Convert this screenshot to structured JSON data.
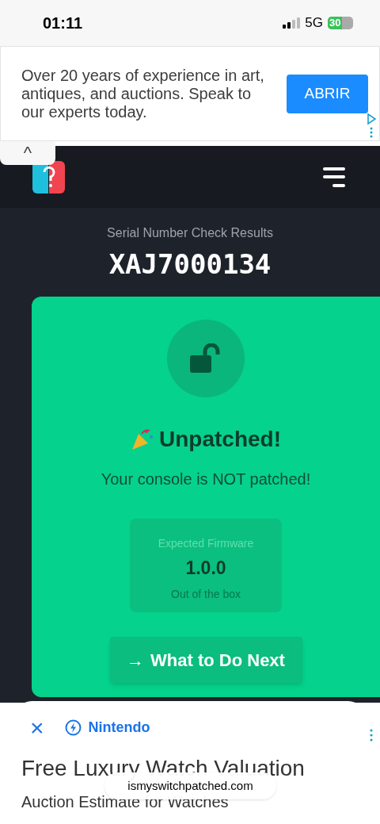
{
  "status_bar": {
    "time": "01:11",
    "network": "5G",
    "battery": "30"
  },
  "ad_banner": {
    "text": "Over 20 years of experience in art, antiques, and auctions. Speak to our experts today.",
    "button": "ABRIR"
  },
  "collapse_tab": {
    "glyph": "^"
  },
  "result": {
    "subtitle": "Serial Number Check Results",
    "serial": "XAJ7000134",
    "status": "Unpatched!",
    "message": "Your console is NOT patched!",
    "firmware": {
      "label": "Expected Firmware",
      "version": "1.0.0",
      "note": "Out of the box"
    },
    "button": {
      "arrow": "→",
      "label": "What to Do Next"
    }
  },
  "bottom_ad": {
    "close": "×",
    "advertiser": "Nintendo",
    "headline": "Free Luxury Watch Valuation",
    "subheadline": "Auction Estimate for Watches"
  },
  "url_pill": "ismyswitchpatched.com"
}
